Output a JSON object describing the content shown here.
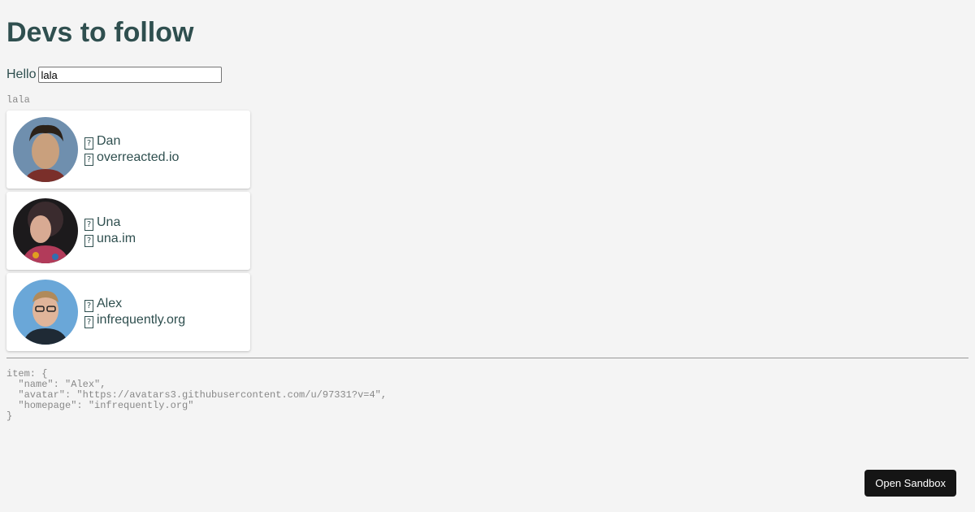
{
  "title": "Devs to follow",
  "greeting": {
    "label": "Hello",
    "input_value": "lala",
    "echo": "lala"
  },
  "devs": [
    {
      "icon_name": "Dan",
      "icon_home": "overreacted.io",
      "name": "Dan",
      "homepage": "overreacted.io",
      "glyph": "?",
      "avatar_colors": [
        "#6f8fae",
        "#c9a07d",
        "#2b2118"
      ]
    },
    {
      "icon_name": "Una",
      "icon_home": "una.im",
      "name": "Una",
      "homepage": "una.im",
      "glyph": "?",
      "avatar_colors": [
        "#1c1a1c",
        "#d8aa93",
        "#3a2b2e"
      ]
    },
    {
      "icon_name": "Alex",
      "icon_home": "infrequently.org",
      "name": "Alex",
      "homepage": "infrequently.org",
      "glyph": "?",
      "avatar_colors": [
        "#6aa7d8",
        "#e0b59a",
        "#1f2a35"
      ]
    }
  ],
  "debug": {
    "line1": "item: {",
    "line2": "  \"name\": \"Alex\",",
    "line3": "  \"avatar\": \"https://avatars3.githubusercontent.com/u/97331?v=4\",",
    "line4": "  \"homepage\": \"infrequently.org\"",
    "line5": "}"
  },
  "sandbox_button": "Open Sandbox"
}
